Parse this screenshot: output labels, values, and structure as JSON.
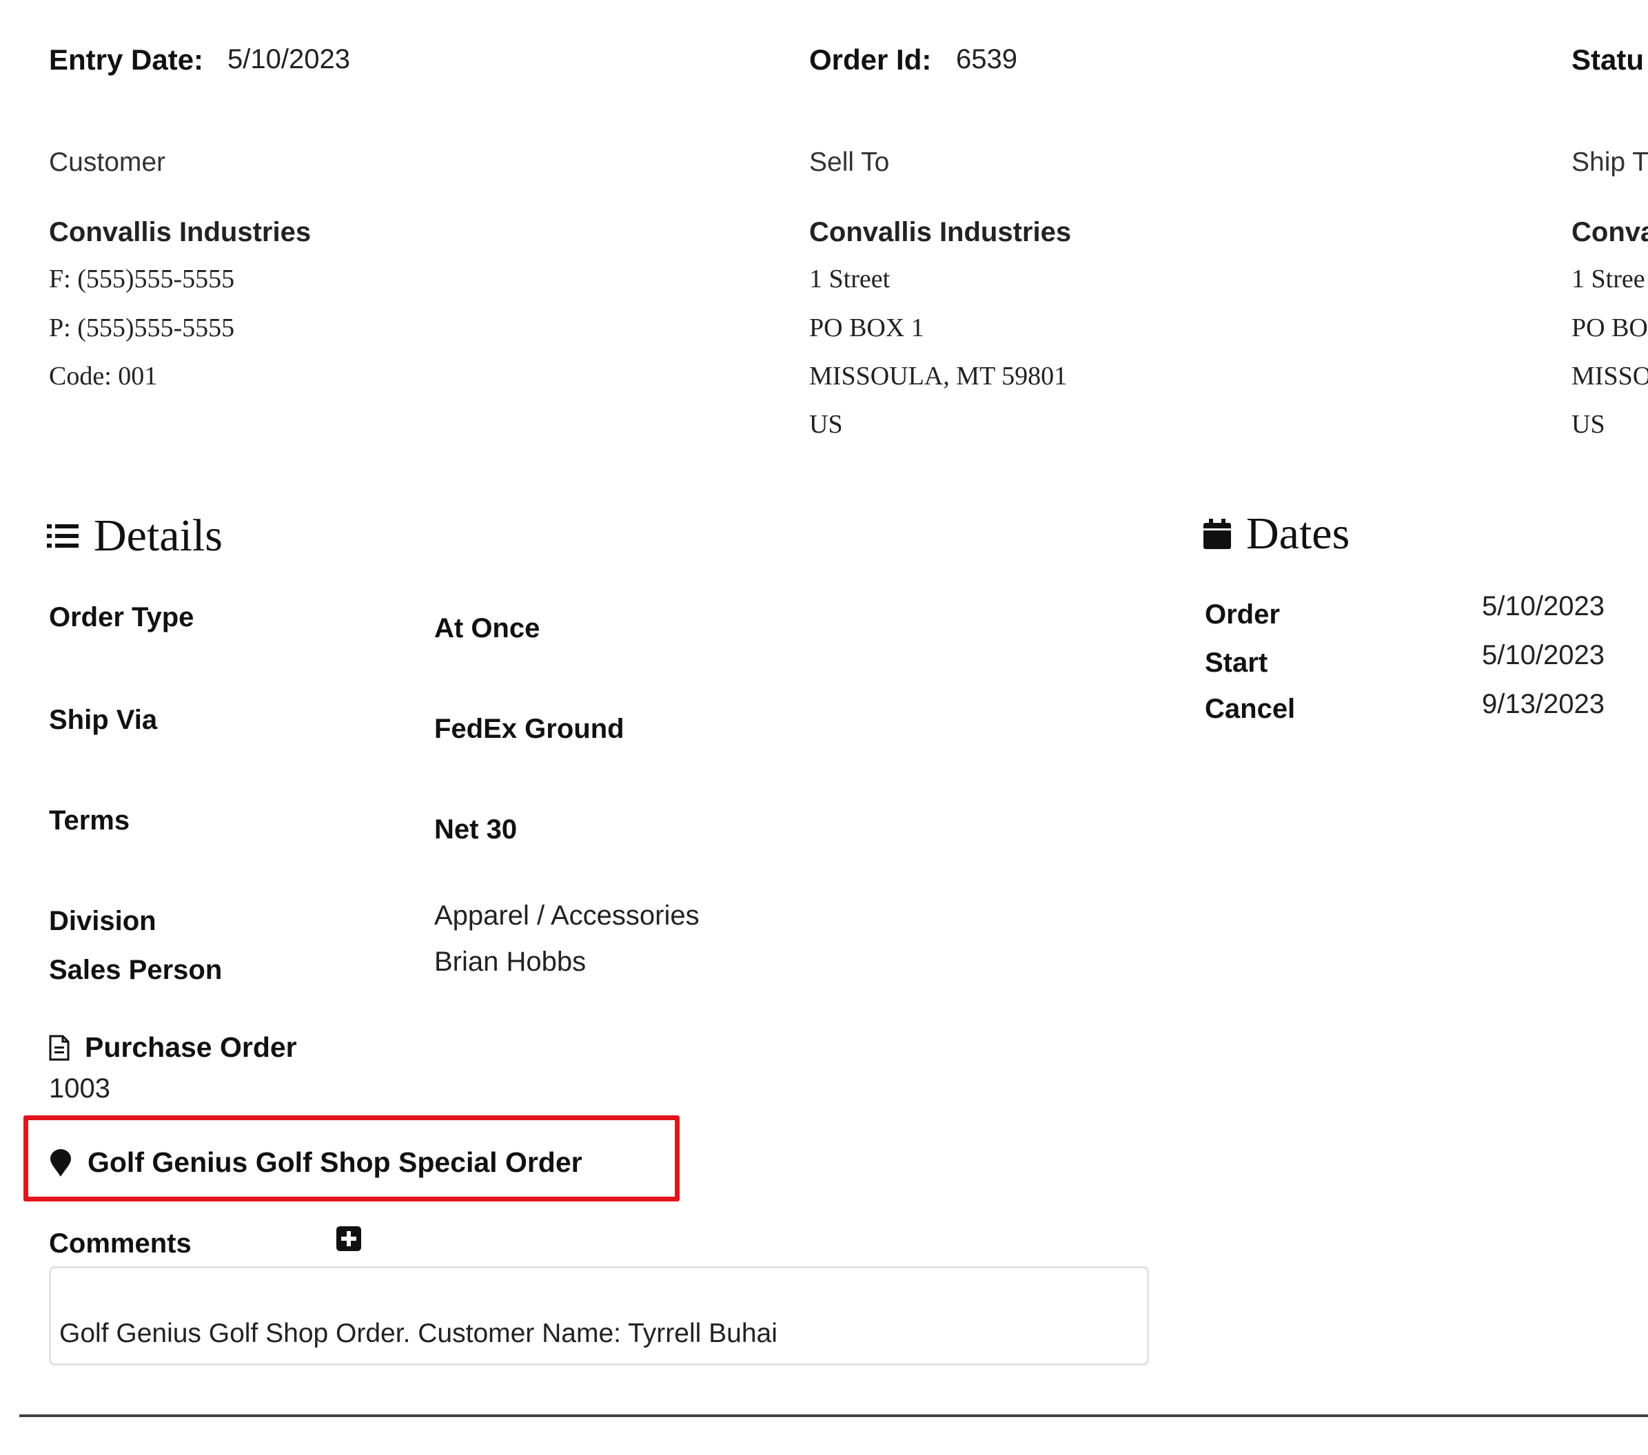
{
  "header": {
    "entry_date_label": "Entry Date:",
    "entry_date_value": "5/10/2023",
    "order_id_label": "Order Id:",
    "order_id_value": "6539",
    "status_label": "Statu"
  },
  "customer": {
    "title": "Customer",
    "name": "Convallis Industries",
    "fax": "F: (555)555-5555",
    "phone": "P: (555)555-5555",
    "code": "Code:  001"
  },
  "sell_to": {
    "title": "Sell To",
    "name": "Convallis Industries",
    "line1": "1 Street",
    "line2": "PO BOX 1",
    "line3": "MISSOULA, MT 59801",
    "line4": "US"
  },
  "ship_to": {
    "title": "Ship T",
    "name": "Conva",
    "line1": "1 Stree",
    "line2": "PO BO",
    "line3": "MISSO",
    "line4": "US"
  },
  "details": {
    "title": "Details",
    "icon": "list-icon",
    "order_type_label": "Order Type",
    "order_type_value": "At Once",
    "ship_via_label": "Ship Via",
    "ship_via_value": "FedEx Ground",
    "terms_label": "Terms",
    "terms_value": "Net 30",
    "division_label": "Division",
    "division_value": "Apparel / Accessories",
    "sales_person_label": "Sales Person",
    "sales_person_value": "Brian Hobbs"
  },
  "dates": {
    "title": "Dates",
    "icon": "calendar-icon",
    "order_label": "Order",
    "order_value": "5/10/2023",
    "start_label": "Start",
    "start_value": "5/10/2023",
    "cancel_label": "Cancel",
    "cancel_value": "9/13/2023"
  },
  "purchase_order": {
    "title": "Purchase Order",
    "icon": "document-icon",
    "value": "1003"
  },
  "special_order": {
    "label": "Golf Genius Golf Shop Special Order",
    "icon": "map-marker-icon",
    "highlight_color": "#e3141b"
  },
  "comments": {
    "label": "Comments",
    "add_icon": "plus-square-icon",
    "text": "Golf Genius Golf Shop Order. Customer Name: Tyrrell Buhai"
  }
}
